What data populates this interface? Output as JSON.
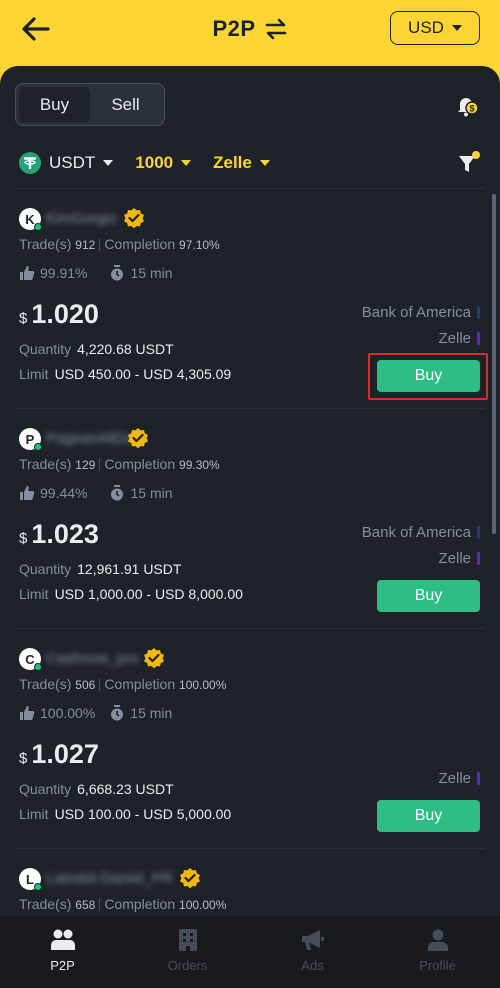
{
  "header": {
    "title": "P2P",
    "currency": "USD"
  },
  "tabs": {
    "buy": "Buy",
    "sell": "Sell"
  },
  "filters": {
    "asset": "USDT",
    "amount": "1000",
    "payment": "Zelle"
  },
  "colors": {
    "brand_yellow": "#fcd535",
    "buy_green": "#2ebd85",
    "background": "#1e2329",
    "highlight_red": "#e02a2a"
  },
  "ads": [
    {
      "initial": "K",
      "name": "KimGorgio",
      "trades_label": "Trade(s)",
      "trades": "912",
      "completion_label": "Completion",
      "completion": "97.10%",
      "rating": "99.91%",
      "time": "15 min",
      "currency_symbol": "$",
      "price": "1.020",
      "quantity_label": "Quantity",
      "quantity": "4,220.68 USDT",
      "limit_label": "Limit",
      "limit": "USD 450.00 - USD 4,305.09",
      "payment_methods": [
        {
          "name": "Bank of America",
          "color": "#1a3a8a"
        },
        {
          "name": "Zelle",
          "color": "#6d1ed4"
        }
      ],
      "button": "Buy"
    },
    {
      "initial": "P",
      "name": "PageanAllDo",
      "trades_label": "Trade(s)",
      "trades": "129",
      "completion_label": "Completion",
      "completion": "99.30%",
      "rating": "99.44%",
      "time": "15 min",
      "currency_symbol": "$",
      "price": "1.023",
      "quantity_label": "Quantity",
      "quantity": "12,961.91 USDT",
      "limit_label": "Limit",
      "limit": "USD 1,000.00 - USD 8,000.00",
      "payment_methods": [
        {
          "name": "Bank of America",
          "color": "#1a3a8a"
        },
        {
          "name": "Zelle",
          "color": "#6d1ed4"
        }
      ],
      "button": "Buy"
    },
    {
      "initial": "C",
      "name": "Cashnow_pro",
      "trades_label": "Trade(s)",
      "trades": "506",
      "completion_label": "Completion",
      "completion": "100.00%",
      "rating": "100.00%",
      "time": "15 min",
      "currency_symbol": "$",
      "price": "1.027",
      "quantity_label": "Quantity",
      "quantity": "6,668.23 USDT",
      "limit_label": "Limit",
      "limit": "USD 100.00 - USD 5,000.00",
      "payment_methods": [
        {
          "name": "Zelle",
          "color": "#6d1ed4"
        }
      ],
      "button": "Buy"
    },
    {
      "initial": "L",
      "name": "Latrobit-Daniel_PR",
      "trades_label": "Trade(s)",
      "trades": "658",
      "completion_label": "Completion",
      "completion": "100.00%"
    }
  ],
  "bottom_nav": [
    {
      "label": "P2P",
      "icon": "p2p-users-icon",
      "active": true
    },
    {
      "label": "Orders",
      "icon": "orders-building-icon",
      "active": false
    },
    {
      "label": "Ads",
      "icon": "megaphone-icon",
      "active": false
    },
    {
      "label": "Profile",
      "icon": "profile-icon",
      "active": false
    }
  ]
}
